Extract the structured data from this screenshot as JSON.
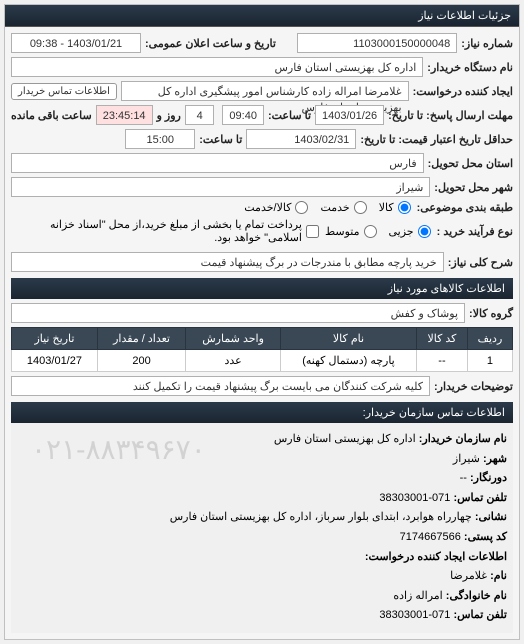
{
  "panel_title": "جزئیات اطلاعات نیاز",
  "header": {
    "req_no_label": "شماره نیاز:",
    "req_no": "1103000150000048",
    "date_label": "تاریخ و ساعت اعلان عمومی:",
    "date_value": "1403/01/21 - 09:38",
    "requester_name_label": "نام دستگاه خریدار:",
    "requester_name": "اداره کل بهزیستی استان فارس",
    "creator_label": "ایجاد کننده درخواست:",
    "creator": "غلامرضا امراله زاده کارشناس امور پیشگیری اداره کل بهزیستی استان فارس",
    "contact_btn": "اطلاعات تماس خریدار",
    "deadline_label": "مهلت ارسال پاسخ: تا تاریخ:",
    "deadline_date": "1403/01/26",
    "deadline_time_label": "تا ساعت:",
    "deadline_time": "09:40",
    "remaining_label": "ساعت باقی مانده",
    "remaining_days": "4",
    "days_label": "روز و",
    "remaining_time": "23:45:14",
    "validity_label": "حداقل تاریخ اعتبار قیمت: تا تاریخ:",
    "validity_date": "1403/02/31",
    "validity_time_label": "تا ساعت:",
    "validity_time": "15:00",
    "province_label": "استان محل تحویل:",
    "province": "فارس",
    "city_label": "شهر محل تحویل:",
    "city": "شیراز",
    "category_label": "طبقه بندی موضوعی:",
    "cat_goods": "کالا",
    "cat_service": "خدمت",
    "cat_both": "کالا/خدمت",
    "process_label": "نوع فرآیند خرید :",
    "proc_partial": "جزیی",
    "proc_medium": "متوسط",
    "proc_note": "پرداخت تمام یا بخشی از مبلغ خرید،از محل \"اسناد خزانه اسلامی\" خواهد بود.",
    "desc_label": "شرح کلی نیاز:",
    "desc_value": "خرید پارچه مطابق با مندرجات در برگ پیشنهاد قیمت"
  },
  "goods_section": {
    "title": "اطلاعات کالاهای مورد نیاز",
    "group_label": "گروه کالا:",
    "group_value": "پوشاک و کفش",
    "columns": [
      "ردیف",
      "کد کالا",
      "نام کالا",
      "واحد شمارش",
      "تعداد / مقدار",
      "تاریخ نیاز"
    ],
    "rows": [
      {
        "idx": "1",
        "code": "--",
        "name": "پارچه (دستمال کهنه)",
        "unit": "عدد",
        "qty": "200",
        "date": "1403/01/27"
      }
    ],
    "buyer_notes_label": "توضیحات خریدار:",
    "buyer_notes": "کلیه شرکت کنندگان می بایست برگ پیشنهاد قیمت را تکمیل کنند"
  },
  "contact": {
    "title": "اطلاعات تماس سازمان خریدار:",
    "org_label": "نام سازمان خریدار:",
    "org": "اداره کل بهزیستی استان فارس",
    "city_label": "شهر:",
    "city": "شیراز",
    "zone_label": "دورنگار:",
    "zone": "--",
    "phone_label": "تلفن تماس:",
    "phone": "071-38303001",
    "addr_label": "نشانی:",
    "addr": "چهارراه هوابرد، ابتدای بلوار سرباز، اداره کل بهزیستی استان فارس",
    "postal_label": "کد پستی:",
    "postal": "7174667566",
    "creator_title": "اطلاعات ایجاد کننده درخواست:",
    "fname_label": "نام:",
    "fname": "غلامرضا",
    "lname_label": "نام خانوادگی:",
    "lname": "امراله زاده",
    "cphone_label": "تلفن تماس:",
    "cphone": "071-38303001",
    "watermark": "۰۲۱-۸۸۳۴۹۶۷۰"
  }
}
